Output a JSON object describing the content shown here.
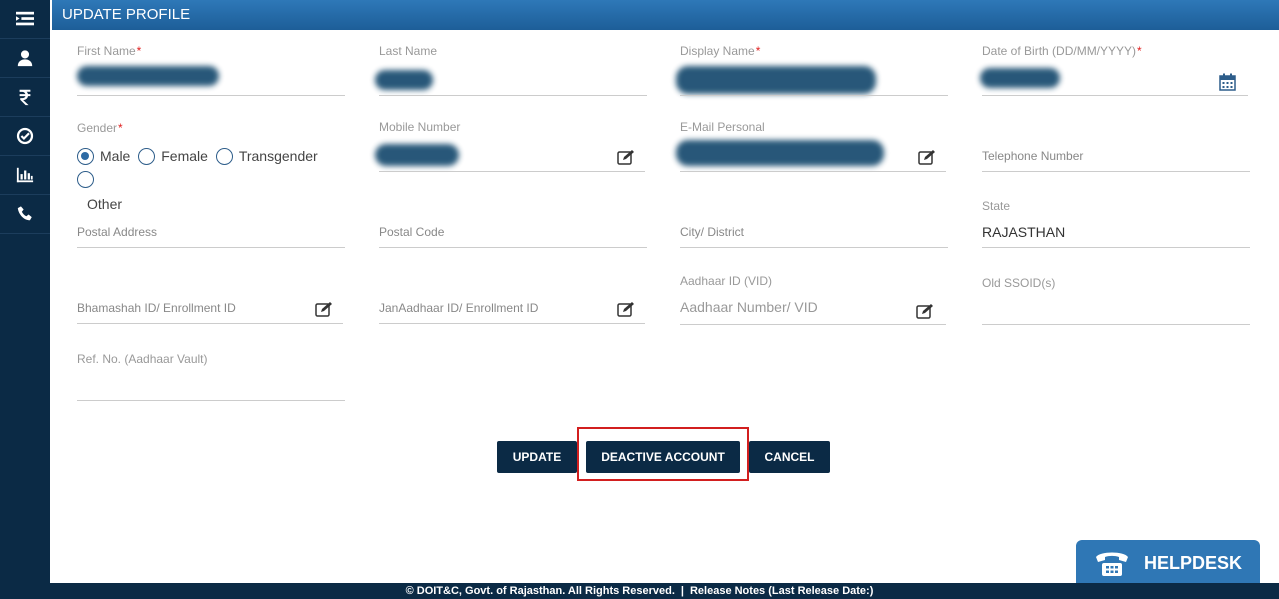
{
  "header": {
    "title": "UPDATE PROFILE"
  },
  "sidebar": {
    "items": [
      {
        "icon": "menu-icon"
      },
      {
        "icon": "user-icon"
      },
      {
        "icon": "rupee-icon"
      },
      {
        "icon": "check-circle-icon"
      },
      {
        "icon": "bar-chart-icon"
      },
      {
        "icon": "phone-icon"
      }
    ]
  },
  "form": {
    "first_name": {
      "label": "First Name",
      "required": "*"
    },
    "last_name": {
      "label": "Last Name"
    },
    "display_name": {
      "label": "Display Name",
      "required": "*"
    },
    "dob": {
      "label": "Date of Birth (DD/MM/YYYY)",
      "required": "*"
    },
    "gender": {
      "label": "Gender",
      "required": "*",
      "options": [
        "Male",
        "Female",
        "Transgender",
        "Other"
      ],
      "selected": "Male"
    },
    "mobile": {
      "label": "Mobile Number"
    },
    "email": {
      "label": "E-Mail Personal"
    },
    "telephone": {
      "placeholder": "Telephone Number"
    },
    "postal_address": {
      "placeholder": "Postal Address"
    },
    "postal_code": {
      "placeholder": "Postal Code"
    },
    "city": {
      "placeholder": "City/ District"
    },
    "state": {
      "label": "State",
      "value": "RAJASTHAN"
    },
    "aadhaar": {
      "label": "Aadhaar ID (VID)",
      "placeholder": "Aadhaar Number/ VID"
    },
    "old_ssoid": {
      "label": "Old SSOID(s)"
    },
    "bhamashah": {
      "placeholder": "Bhamashah ID/ Enrollment ID"
    },
    "janaadhaar": {
      "placeholder": "JanAadhaar ID/ Enrollment ID"
    },
    "ref_no": {
      "label": "Ref. No. (Aadhaar Vault)"
    }
  },
  "buttons": {
    "update": "UPDATE",
    "deactivate": "DEACTIVE ACCOUNT",
    "cancel": "CANCEL"
  },
  "helpdesk": {
    "label": "HELPDESK",
    "icon": "telephone-icon"
  },
  "footer": {
    "copyright": "© DOIT&C, Govt. of Rajasthan. All Rights Reserved.",
    "separator": "|",
    "release_notes": "Release Notes (Last Release Date:)"
  },
  "colors": {
    "sidebar": "#0b2a45",
    "header": "#2e78b8",
    "button": "#0b2a45",
    "highlight": "#d21f1f",
    "required": "#e02020"
  }
}
